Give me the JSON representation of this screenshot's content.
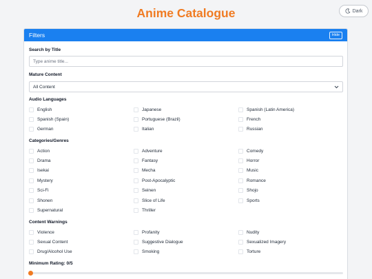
{
  "app": {
    "title": "Anime Catalogue",
    "theme_label": "Dark"
  },
  "filters": {
    "header": "Filters",
    "hide_label": "Hide",
    "search": {
      "label": "Search by Title",
      "placeholder": "Type anime title..."
    },
    "mature": {
      "label": "Mature Content",
      "value": "All Content"
    },
    "audio": {
      "label": "Audio Languages",
      "options": [
        "English",
        "Japanese",
        "Spanish (Latin America)",
        "Spanish (Spain)",
        "Portuguese (Brazil)",
        "French",
        "German",
        "Italian",
        "Russian"
      ]
    },
    "genres": {
      "label": "Categories/Genres",
      "options": [
        "Action",
        "Adventure",
        "Comedy",
        "Drama",
        "Fantasy",
        "Horror",
        "Isekai",
        "Mecha",
        "Music",
        "Mystery",
        "Post-Apocalyptic",
        "Romance",
        "Sci-Fi",
        "Seinen",
        "Shojo",
        "Shonen",
        "Slice of Life",
        "Sports",
        "Supernatural",
        "Thriller"
      ]
    },
    "warnings": {
      "label": "Content Warnings",
      "options": [
        "Violence",
        "Profanity",
        "Nudity",
        "Sexual Content",
        "Suggestive Dialogue",
        "Sexualized Imagery",
        "Drug/Alcohol Use",
        "Smoking",
        "Torture"
      ]
    },
    "rating": {
      "label": "Minimum Rating: 0/5",
      "value": 0,
      "max": 5
    }
  },
  "colors": {
    "accent": "#f07b22",
    "panel_header": "#1a80f0"
  }
}
